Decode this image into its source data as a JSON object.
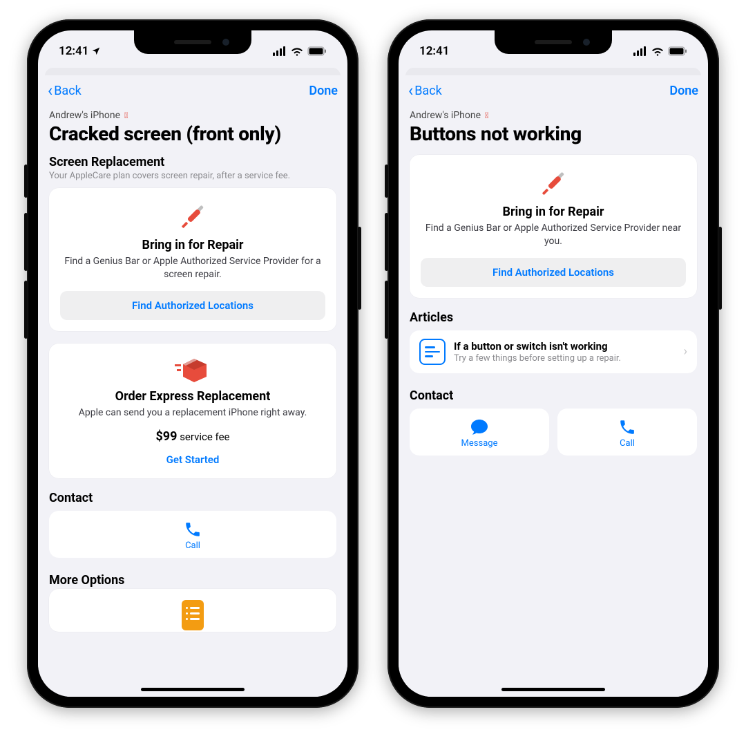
{
  "status": {
    "time_left": "12:41",
    "time_right": "12:41",
    "location_on": true
  },
  "nav": {
    "back_label": "Back",
    "done_label": "Done"
  },
  "device_name": "Andrew's iPhone",
  "left": {
    "title": "Cracked screen (front only)",
    "section1_title": "Screen Replacement",
    "section1_sub": "Your AppleCare plan covers screen repair, after a service fee.",
    "card1": {
      "title": "Bring in for Repair",
      "desc": "Find a Genius Bar or Apple Authorized Service Provider for a screen repair.",
      "button": "Find Authorized Locations"
    },
    "card2": {
      "title": "Order Express Replacement",
      "desc": "Apple can send you a replacement iPhone right away.",
      "fee_amount": "$99",
      "fee_suffix": " service fee",
      "button": "Get Started"
    },
    "contact_title": "Contact",
    "contact_call": "Call",
    "more_title": "More Options"
  },
  "right": {
    "title": "Buttons not working",
    "card1": {
      "title": "Bring in for Repair",
      "desc": "Find a Genius Bar or Apple Authorized Service Provider near you.",
      "button": "Find Authorized Locations"
    },
    "articles_title": "Articles",
    "article": {
      "title": "If a button or switch isn't working",
      "sub": "Try a few things before setting up a repair."
    },
    "contact_title": "Contact",
    "contact_message": "Message",
    "contact_call": "Call"
  }
}
